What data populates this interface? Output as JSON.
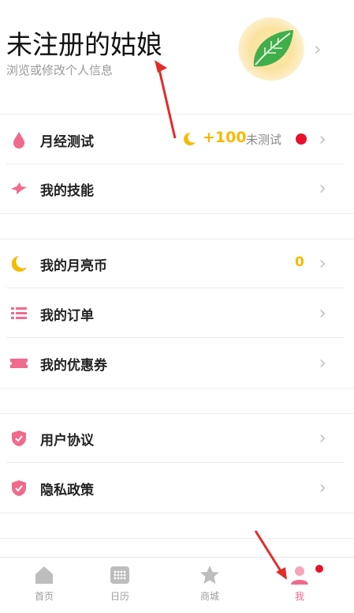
{
  "profile": {
    "name": "未注册的姑娘",
    "subtitle": "浏览或修改个人信息"
  },
  "menu": {
    "period_test": {
      "label": "月经测试",
      "bonus": "+100",
      "status": "未测试"
    },
    "skills": {
      "label": "我的技能"
    },
    "moon_coins": {
      "label": "我的月亮币",
      "value": "0"
    },
    "orders": {
      "label": "我的订单"
    },
    "coupons": {
      "label": "我的优惠券"
    },
    "agreement": {
      "label": "用户协议"
    },
    "privacy": {
      "label": "隐私政策"
    }
  },
  "tabbar": {
    "home": "首页",
    "calendar": "日历",
    "mall": "商城",
    "me": "我"
  },
  "colors": {
    "accent": "#f06a8c",
    "gold": "#f6b900",
    "red": "#e8112d"
  },
  "icons": [
    "drop-icon",
    "bird-icon",
    "moon-icon",
    "list-icon",
    "ticket-icon",
    "shield-icon",
    "home-icon",
    "calendar-icon",
    "star-icon",
    "person-icon"
  ]
}
